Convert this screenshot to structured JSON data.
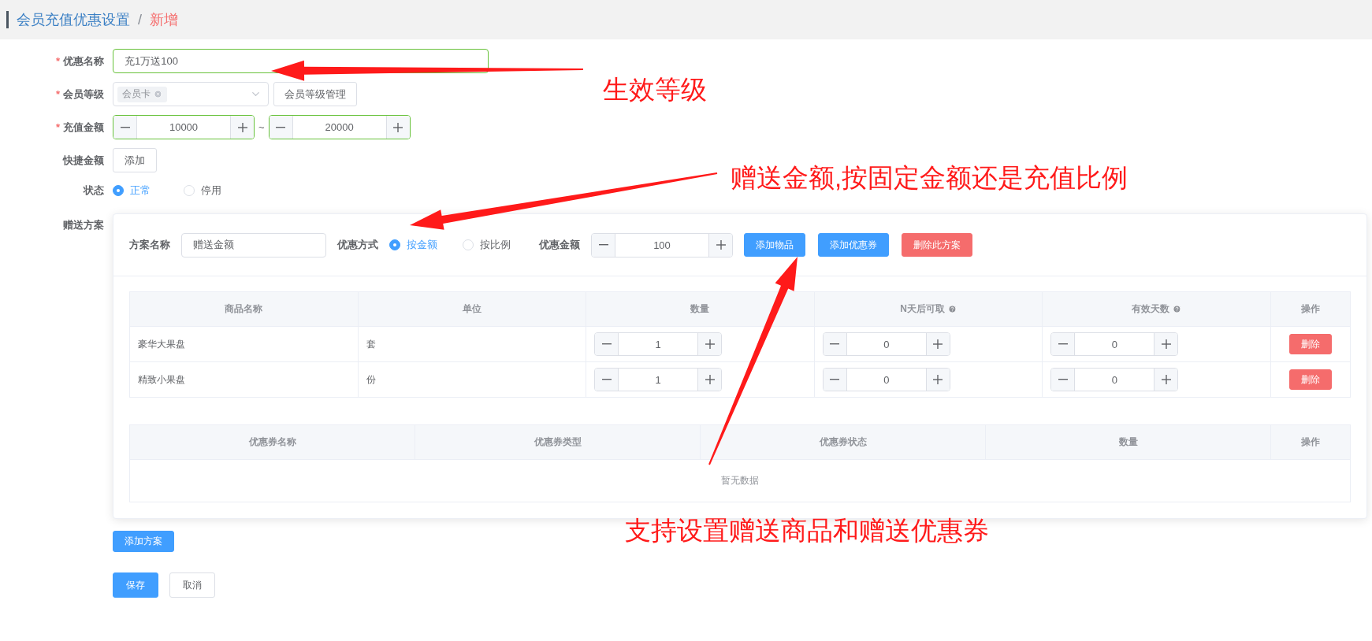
{
  "breadcrumb": [
    {
      "label": "会员充值优惠设置",
      "current": false
    },
    {
      "label": "新增",
      "current": true
    }
  ],
  "breadcrumb_separator": "/",
  "required_mark": "*",
  "form": {
    "name": {
      "label": "优惠名称",
      "required": true,
      "validated": true,
      "value": "充1万送100"
    },
    "level": {
      "label": "会员等级",
      "required": true,
      "validated": false,
      "tags": [
        "会员卡"
      ],
      "manage_button": "会员等级管理"
    },
    "amount": {
      "label": "充值金额",
      "required": true,
      "validated": true,
      "min": "10000",
      "max": "20000",
      "range_separator": "~"
    },
    "quick_amount": {
      "label": "快捷金额",
      "required": false,
      "button": "添加"
    },
    "status": {
      "label": "状态",
      "required": false,
      "options": [
        {
          "label": "正常",
          "selected": true
        },
        {
          "label": "停用",
          "selected": false
        }
      ]
    },
    "plans": {
      "label": "赠送方案",
      "required": false,
      "items": [
        {
          "name_label": "方案名称",
          "name_value": "赠送金额",
          "mode_label": "优惠方式",
          "modes": [
            {
              "label": "按金额",
              "selected": true
            },
            {
              "label": "按比例",
              "selected": false
            }
          ],
          "amount_label": "优惠金额",
          "amount": "100",
          "buttons": [
            {
              "label": "添加物品",
              "kind": "primary"
            },
            {
              "label": "添加优惠券",
              "kind": "primary"
            },
            {
              "label": "删除此方案",
              "kind": "danger"
            }
          ],
          "goods_table": {
            "columns": [
              {
                "label": "商品名称",
                "help": false
              },
              {
                "label": "单位",
                "help": false
              },
              {
                "label": "数量",
                "help": false
              },
              {
                "label": "N天后可取",
                "help": true
              },
              {
                "label": "有效天数",
                "help": true
              },
              {
                "label": "操作",
                "help": false
              }
            ],
            "rows": [
              {
                "name": "豪华大果盘",
                "unit": "套",
                "quantity": "1",
                "days_after": "0",
                "valid_days": "0",
                "action": "删除"
              },
              {
                "name": "精致小果盘",
                "unit": "份",
                "quantity": "1",
                "days_after": "0",
                "valid_days": "0",
                "action": "删除"
              }
            ]
          },
          "coupon_table": {
            "columns": [
              "优惠券名称",
              "优惠券类型",
              "优惠券状态",
              "数量",
              "操作"
            ],
            "empty_text": "暂无数据"
          }
        }
      ]
    },
    "add_plan_button": "添加方案",
    "actions": [
      {
        "label": "保存",
        "kind": "primary"
      },
      {
        "label": "取消",
        "kind": "default"
      }
    ]
  },
  "annotations": [
    {
      "text": "生效等级"
    },
    {
      "text": "赠送金额,按固定金额还是充值比例"
    },
    {
      "text": "支持设置赠送商品和赠送优惠券"
    }
  ]
}
